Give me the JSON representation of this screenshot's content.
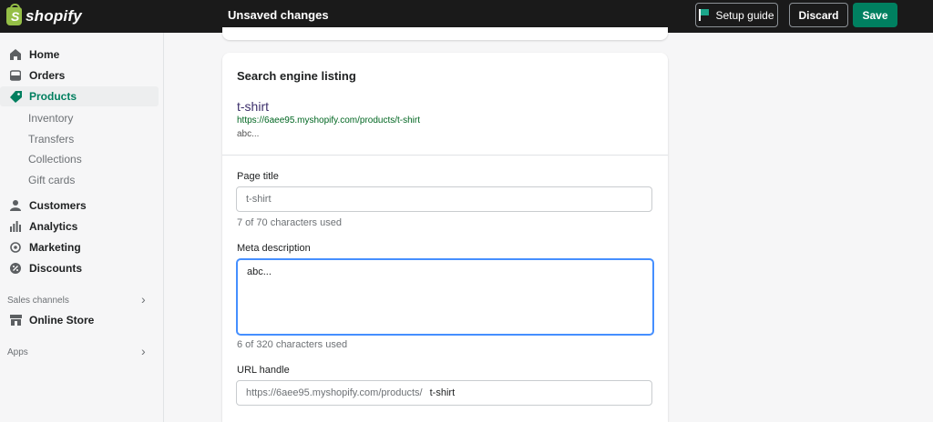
{
  "topbar": {
    "brand": "shopify",
    "status": "Unsaved changes",
    "setup_guide": "Setup guide",
    "discard": "Discard",
    "save": "Save"
  },
  "sidebar": {
    "items": [
      {
        "label": "Home",
        "icon": "home-icon"
      },
      {
        "label": "Orders",
        "icon": "orders-icon"
      },
      {
        "label": "Products",
        "icon": "tag-icon",
        "active": true
      },
      {
        "label": "Customers",
        "icon": "person-icon"
      },
      {
        "label": "Analytics",
        "icon": "bar-chart-icon"
      },
      {
        "label": "Marketing",
        "icon": "target-icon"
      },
      {
        "label": "Discounts",
        "icon": "discount-icon"
      },
      {
        "label": "Online Store",
        "icon": "store-icon"
      }
    ],
    "sub_items": [
      "Inventory",
      "Transfers",
      "Collections",
      "Gift cards"
    ],
    "sales_channels": "Sales channels",
    "apps": "Apps"
  },
  "seo": {
    "title": "Search engine listing",
    "preview_title": "t-shirt",
    "preview_url": "https://6aee95.myshopify.com/products/t-shirt",
    "preview_desc": "abc...",
    "page_title_label": "Page title",
    "page_title_value": "t-shirt",
    "page_title_help": "7 of 70 characters used",
    "meta_label": "Meta description",
    "meta_value": "abc...",
    "meta_help": "6 of 320 characters used",
    "url_label": "URL handle",
    "url_prefix": "https://6aee95.myshopify.com/products/",
    "url_handle": "t-shirt"
  },
  "colors": {
    "topbar": "#1a1a1a",
    "save": "#008060",
    "active_nav": "#007f5f",
    "focus": "#458fff"
  }
}
